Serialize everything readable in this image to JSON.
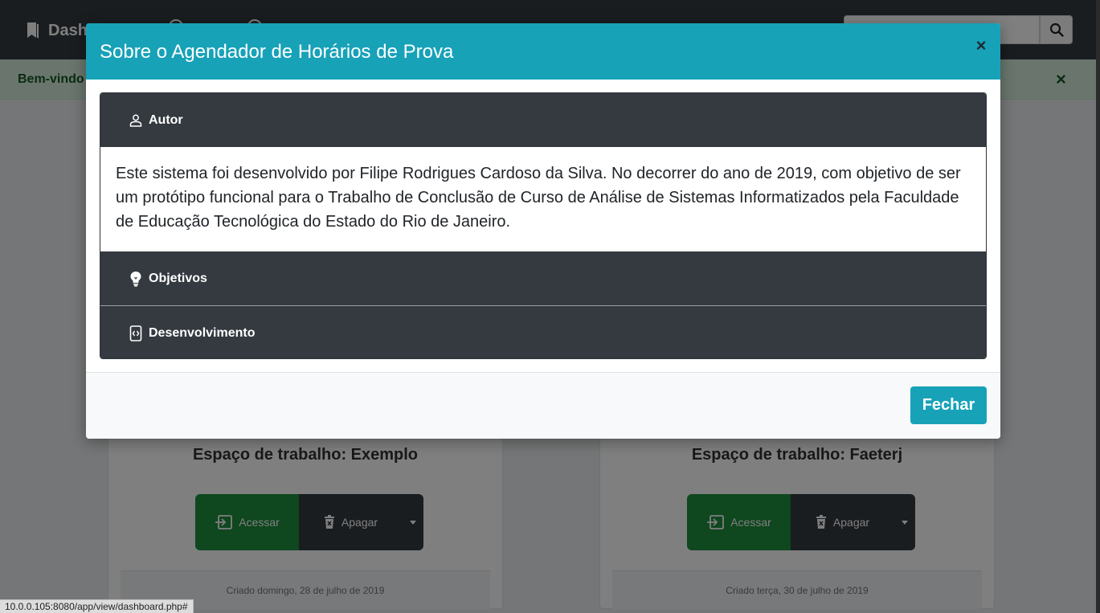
{
  "navbar": {
    "brand_label": "Dashboard"
  },
  "alert": {
    "text": "Bem-vindo a",
    "close_label": "×"
  },
  "workspaces": [
    {
      "title": "Espaço de trabalho: Exemplo",
      "access_label": "Acessar",
      "delete_label": "Apagar",
      "created": "Criado domingo, 28 de julho de 2019"
    },
    {
      "title": "Espaço de trabalho: Faeterj",
      "access_label": "Acessar",
      "delete_label": "Apagar",
      "created": "Criado terça, 30 de julho de 2019"
    }
  ],
  "statusbar": {
    "url": "10.0.0.105:8080/app/view/dashboard.php#"
  },
  "modal": {
    "title": "Sobre o Agendador de Horários de Prova",
    "close_label": "×",
    "sections": [
      {
        "label": "Autor",
        "icon": "person-icon",
        "expanded": true,
        "body": "Este sistema foi desenvolvido por Filipe Rodrigues Cardoso da Silva. No decorrer do ano de 2019, com objetivo de ser um protótipo funcional para o Trabalho de Conclusão de Curso de Análise de Sistemas Informatizados pela Faculdade de Educação Tecnológica do Estado do Rio de Janeiro."
      },
      {
        "label": "Objetivos",
        "icon": "lightbulb-icon",
        "expanded": false
      },
      {
        "label": "Desenvolvimento",
        "icon": "code-device-icon",
        "expanded": false
      }
    ],
    "footer": {
      "close_button_label": "Fechar"
    }
  },
  "colors": {
    "modal_header": "#17a2b8",
    "accordion_header": "#343a40",
    "navbar": "#343a40",
    "alert_bg": "#d4edda",
    "access_button": "#1e8e3e"
  }
}
